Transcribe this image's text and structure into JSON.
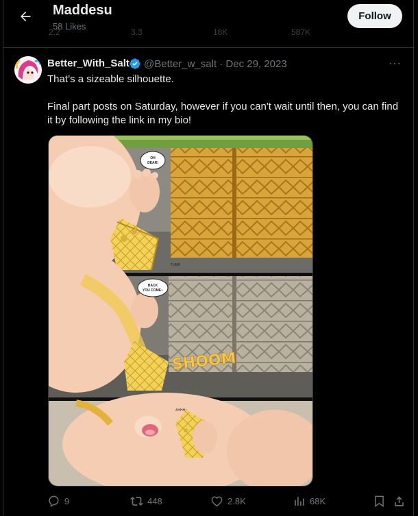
{
  "header": {
    "title": "Maddesu",
    "subtitle": "58 Likes",
    "follow_label": "Follow",
    "ghost_stats": [
      "2.2",
      "3.3",
      "18K",
      "587K"
    ]
  },
  "tweet": {
    "display_name": "Better_With_Salt",
    "handle_date": "@Better_w_salt · Dec 29, 2023",
    "line1": "That’s a sizeable silhouette.",
    "line2": "Final part posts on Saturday, however if you can't wait until then, you can find it by following the link in my bio!",
    "more": "···"
  },
  "comic": {
    "bubble1": "OH DEAR!",
    "bubble2": "BACK YOU COME~",
    "sfx1": "SHOOM",
    "sfx2": "AHHH~",
    "sfx3": "TUMP"
  },
  "actions": {
    "replies": "9",
    "reposts": "448",
    "likes": "2.8K",
    "views": "68K"
  },
  "colors": {
    "background": "#000000",
    "text": "#e7e9ea",
    "muted": "#71767b",
    "verified": "#1d9bf0",
    "follow_bg": "#eff3f4"
  }
}
